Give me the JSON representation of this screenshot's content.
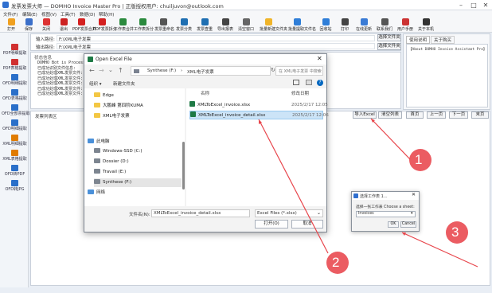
{
  "app": {
    "title": "发票发票大师 — DOMHO Invoice Master Pro | 正版授权用户: chuiljuvon@outlook.com",
    "window_controls": [
      "–",
      "□",
      "✕"
    ]
  },
  "menu": [
    "文件(F)",
    "编辑(E)",
    "视图(V)",
    "工具(T)",
    "数据(D)",
    "帮助(H)"
  ],
  "toolbar": [
    {
      "label": "打开",
      "icon": "folder-icon",
      "color": "#f0a020"
    },
    {
      "label": "保存",
      "icon": "save-icon",
      "color": "#3b6fc9"
    },
    {
      "label": "关闭",
      "icon": "close-icon",
      "color": "#d33"
    },
    {
      "label": "退出",
      "icon": "exit-icon",
      "color": "#c22"
    },
    {
      "label": "PDF发票合并",
      "icon": "pdf-icon",
      "color": "#d42020"
    },
    {
      "label": "PDF发票拆分",
      "icon": "pdf-split-icon",
      "color": "#d42020"
    },
    {
      "label": "工作表合并",
      "icon": "merge-icon",
      "color": "#2b8a3e"
    },
    {
      "label": "工作表拆分",
      "icon": "split-icon",
      "color": "#2b8a3e"
    },
    {
      "label": "发票重命名",
      "icon": "rename-icon",
      "color": "#555"
    },
    {
      "label": "发票分类",
      "icon": "classify-icon",
      "color": "#1f6fb2"
    },
    {
      "label": "发票查重",
      "icon": "dup-check-icon",
      "color": "#1f6fb2"
    },
    {
      "label": "导出报表",
      "icon": "report-icon",
      "color": "#444"
    },
    {
      "label": "清空窗口",
      "icon": "clear-icon",
      "color": "#666"
    },
    {
      "label": "批量新建文件夹",
      "icon": "new-folder-icon",
      "color": "#f0b429"
    },
    {
      "label": "批量提取文件名",
      "icon": "extract-icon",
      "color": "#2f7ed8"
    },
    {
      "label": "回收站",
      "icon": "recycle-icon",
      "color": "#2f7ed8"
    },
    {
      "label": "打印",
      "icon": "print-icon",
      "color": "#444"
    },
    {
      "label": "在线更新",
      "icon": "update-icon",
      "color": "#3a7bd5"
    },
    {
      "label": "联系我们",
      "icon": "contact-icon",
      "color": "#555"
    },
    {
      "label": "用户手册",
      "icon": "manual-icon",
      "color": "#c33"
    },
    {
      "label": "关于本机",
      "icon": "about-icon",
      "color": "#333"
    }
  ],
  "sidebar": [
    {
      "label": "PDF明细提取",
      "color": "#d03030"
    },
    {
      "label": "PDF表格提取",
      "color": "#d03030"
    },
    {
      "label": "OFD明细提取",
      "color": "#2a6fc9"
    },
    {
      "label": "OFD表格提取",
      "color": "#2a6fc9"
    },
    {
      "label": "OFD全部票提取",
      "color": "#2a6fc9"
    },
    {
      "label": "OFD明细提取",
      "color": "#2a6fc9"
    },
    {
      "label": "XML明细提取",
      "color": "#e07b00"
    },
    {
      "label": "XML表格提取",
      "color": "#e07b00"
    },
    {
      "label": "OFD转PDF",
      "color": "#2a6fc9"
    },
    {
      "label": "OFD转JPG",
      "color": "#2a6fc9"
    }
  ],
  "main": {
    "input_label": "输入路径:",
    "input_value": "F:\\XML电子发票",
    "output_label": "输出路径:",
    "output_value": "F:\\XML电子发票",
    "select_input_btn": "选择文件夹",
    "select_output_btn": "选择文件夹",
    "tabs": [
      "使用说明",
      "关于购买"
    ],
    "about_text": "【About DOMHO Invoice Assistant Pro】",
    "status_header": "状态信息",
    "log_lines": [
      "DOMHO Bot is Processing...",
      "已成功识别文件信息:",
      "已成功处理XML发票文件:",
      "已成功处理XML发票文件:",
      "已成功处理XML发票文件:",
      "已成功处理XML发票文件:",
      "已成功处理XML发票文件:"
    ],
    "list_header": "发票列表区",
    "buttons": [
      "导入Excel",
      "清空列表",
      "首页",
      "上一页",
      "下一页",
      "末页"
    ]
  },
  "file_dialog": {
    "title": "Open Excel File",
    "breadcrumb": [
      "Synthese (F:)",
      "XML电子发票"
    ],
    "search_placeholder": "在 XML电子发票 中搜索",
    "organize": "组织 ▾",
    "new_folder": "新建文件夹",
    "tree": [
      {
        "label": "Edge",
        "type": "folder"
      },
      {
        "label": "大鹏峰 第四阶KUMA",
        "type": "folder"
      },
      {
        "label": "XML电子发票",
        "type": "folder"
      },
      {
        "label": "此电脑",
        "type": "pc"
      },
      {
        "label": "Windows-SSD (C:)",
        "type": "drive"
      },
      {
        "label": "Dossier (D:)",
        "type": "drive"
      },
      {
        "label": "Travail (E:)",
        "type": "drive"
      },
      {
        "label": "Synthese (F:)",
        "type": "drive"
      },
      {
        "label": "网络",
        "type": "net"
      }
    ],
    "col_name": "名称",
    "col_date": "修改日期",
    "files": [
      {
        "name": "XMLToExcel_invoice.xlsx",
        "date": "2025/2/17 12:05"
      },
      {
        "name": "XMLToExcel_invoice_detail.xlsx",
        "date": "2025/2/17 12:06"
      }
    ],
    "filename_label": "文件名(N):",
    "filename_value": "XMLToExcel_invoice_detail.xlsx",
    "filetype_value": "Excel Files (*.xlsx)",
    "open_btn": "打开(O)",
    "cancel_btn": "取消"
  },
  "sheet_dialog": {
    "title": "选择工作表 1...",
    "prompt": "选择一张工作表 Choose a sheet:",
    "select_value": "Invoices",
    "ok_btn": "OK",
    "cancel_btn": "Cancel"
  },
  "annotations": [
    "1",
    "2",
    "3"
  ],
  "colors": {
    "annotation": "#e8464c",
    "accent": "#0067c0",
    "selected_row": "#cce4f7"
  }
}
